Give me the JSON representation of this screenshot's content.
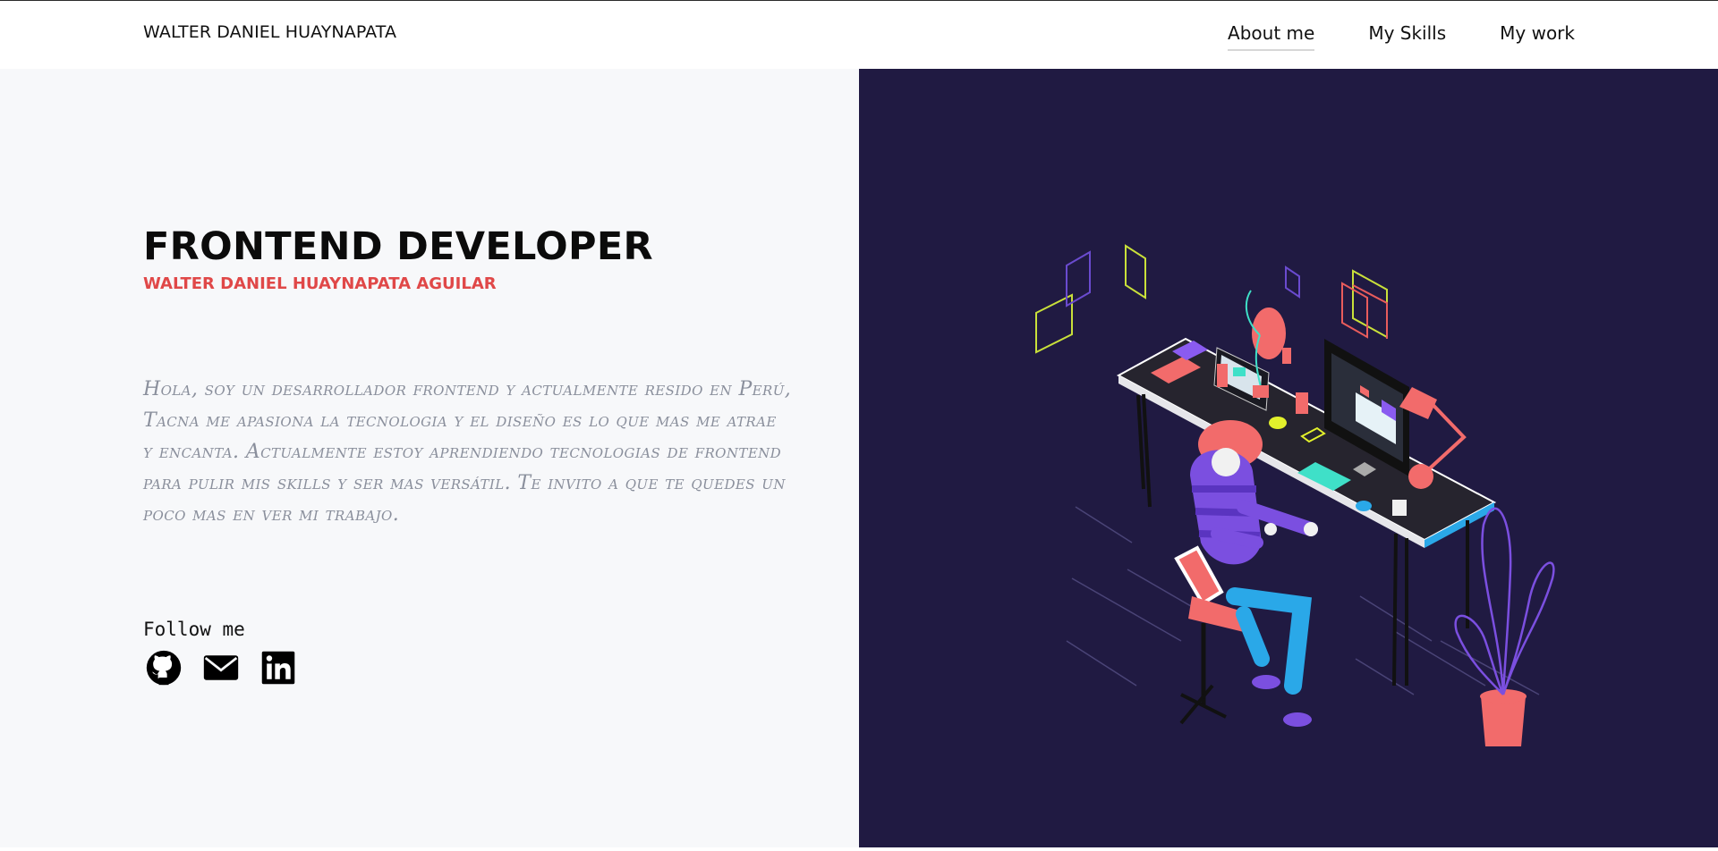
{
  "header": {
    "brand": "WALTER DANIEL HUAYNAPATA",
    "nav": [
      {
        "label": "About me",
        "active": true
      },
      {
        "label": "My Skills",
        "active": false
      },
      {
        "label": "My work",
        "active": false
      }
    ]
  },
  "hero": {
    "title": "FRONTEND DEVELOPER",
    "subtitle": "WALTER DANIEL HUAYNAPATA AGUILAR",
    "bio": "Hola, soy un desarrollador frontend y actualmente resido en Perú, Tacna me apasiona la tecnologia y el diseño es lo que mas me atrae y encanta. Actualmente estoy aprendiendo tecnologias de frontend para pulir mis skills y ser mas versátil. Te invito a que te quedes un poco mas en ver mi trabajo."
  },
  "social": {
    "label": "Follow me",
    "icons": [
      "github-icon",
      "mail-icon",
      "linkedin-icon"
    ]
  },
  "colors": {
    "accent": "#e04848",
    "illustration_bg": "#201a42",
    "left_bg": "#f7f8fa"
  }
}
